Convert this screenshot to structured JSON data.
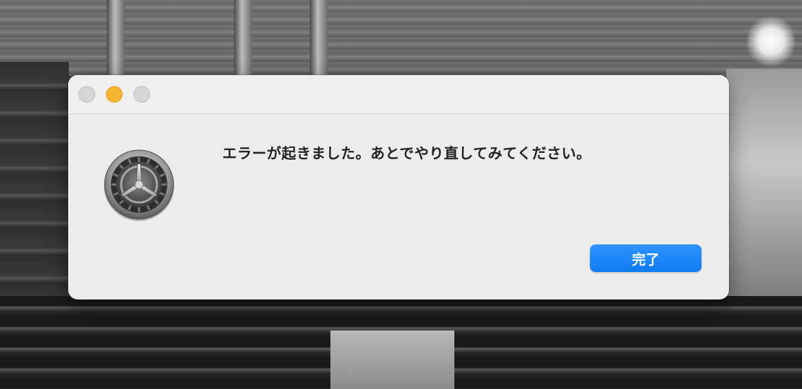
{
  "dialog": {
    "message": "エラーが起きました。あとでやり直してみてください。",
    "done_label": "完了",
    "icon": "system-preferences-gear-icon"
  },
  "window_controls": {
    "close": "close-button",
    "minimize": "minimize-button",
    "zoom": "zoom-button"
  },
  "colors": {
    "accent": "#0d7bf2",
    "minimize": "#f8b532",
    "dialog_background": "#ececec"
  }
}
